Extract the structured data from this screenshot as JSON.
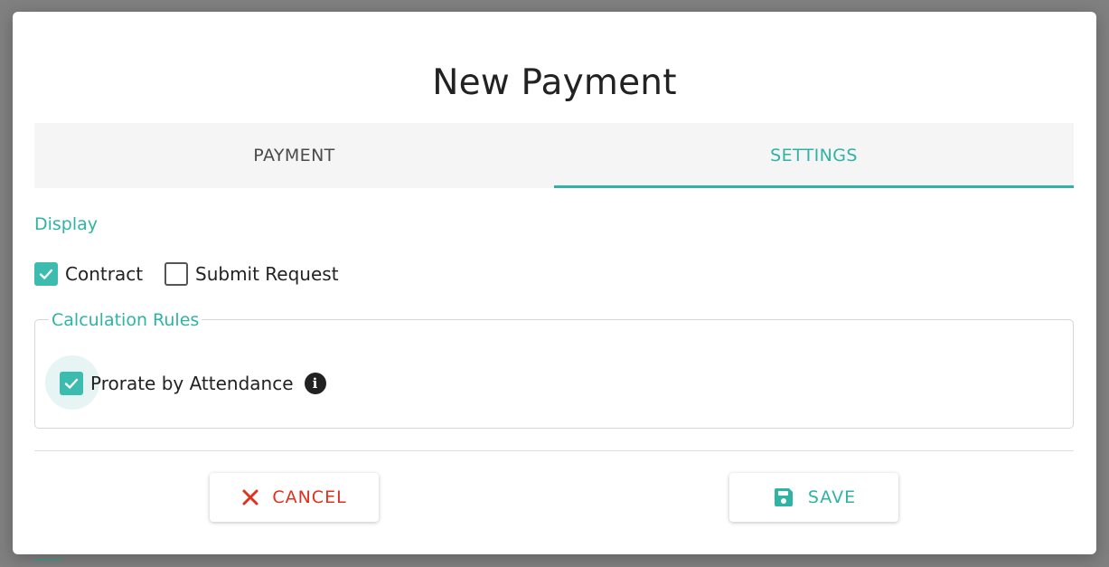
{
  "dialog": {
    "title": "New Payment"
  },
  "tabs": [
    {
      "label": "PAYMENT",
      "active": false
    },
    {
      "label": "SETTINGS",
      "active": true
    }
  ],
  "display": {
    "section_label": "Display",
    "options": [
      {
        "label": "Contract",
        "checked": true
      },
      {
        "label": "Submit Request",
        "checked": false
      }
    ]
  },
  "calculation_rules": {
    "legend": "Calculation Rules",
    "option": {
      "label": "Prorate by Attendance",
      "checked": true
    },
    "info_icon": "info-circle-icon"
  },
  "actions": {
    "cancel_label": "CANCEL",
    "cancel_icon": "close-icon",
    "save_label": "SAVE",
    "save_icon": "floppy-disk-icon"
  },
  "colors": {
    "accent": "#2fb3a4",
    "danger": "#e0301e"
  }
}
